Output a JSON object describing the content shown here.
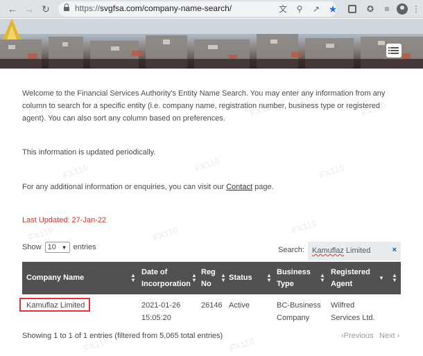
{
  "browser": {
    "url_protocol": "https://",
    "url_rest": "svgfsa.com/company-name-search/",
    "icons": [
      "back-icon",
      "forward-icon",
      "reload-icon",
      "translate-icon",
      "zoom-icon",
      "share-icon",
      "bookmark-star-icon",
      "extension-icon",
      "puzzle-icon",
      "media-icon",
      "profile-icon",
      "kebab-menu-icon"
    ]
  },
  "content": {
    "intro": "Welcome to the Financial Services Authority's Entity Name Search. You may enter any information from any column to search for a specific entity (i.e. company name, registration number, business type or registered agent). You can also sort any column based on preferences.",
    "updated_note": "This information is updated periodically.",
    "enquiry_prefix": "For any additional information or enquiries, you can visit our ",
    "contact_link": "Contact",
    "enquiry_suffix": " page.",
    "last_updated": "Last Updated:  27-Jan-22"
  },
  "controls": {
    "show_label": "Show",
    "page_size": "10",
    "entries_label": "entries",
    "search_label": "Search:",
    "search_value_word1": "Kamuflaz",
    "search_value_word2": " Limited",
    "search_clear": "×"
  },
  "table": {
    "headers": [
      {
        "label": "Company Name"
      },
      {
        "label": "Date of Incorporation"
      },
      {
        "label": "Reg No"
      },
      {
        "label": "Status"
      },
      {
        "label": "Business Type"
      },
      {
        "label": "Registered Agent"
      }
    ],
    "rows": [
      {
        "company": "Kamuflaz Limited",
        "date": "2021-01-26 15:05:20",
        "reg": "26146",
        "status": "Active",
        "type": "BC-Business Company",
        "agent": "Wilfred Services Ltd."
      }
    ]
  },
  "footer": {
    "info": "Showing 1 to 1 of 1 entries (filtered from 5,065 total entries)",
    "previous": "‹Previous",
    "next": "Next ›"
  },
  "colors": {
    "accent_red": "#c9302c",
    "header_bg": "#515151",
    "highlight_box": "#d9343a"
  }
}
